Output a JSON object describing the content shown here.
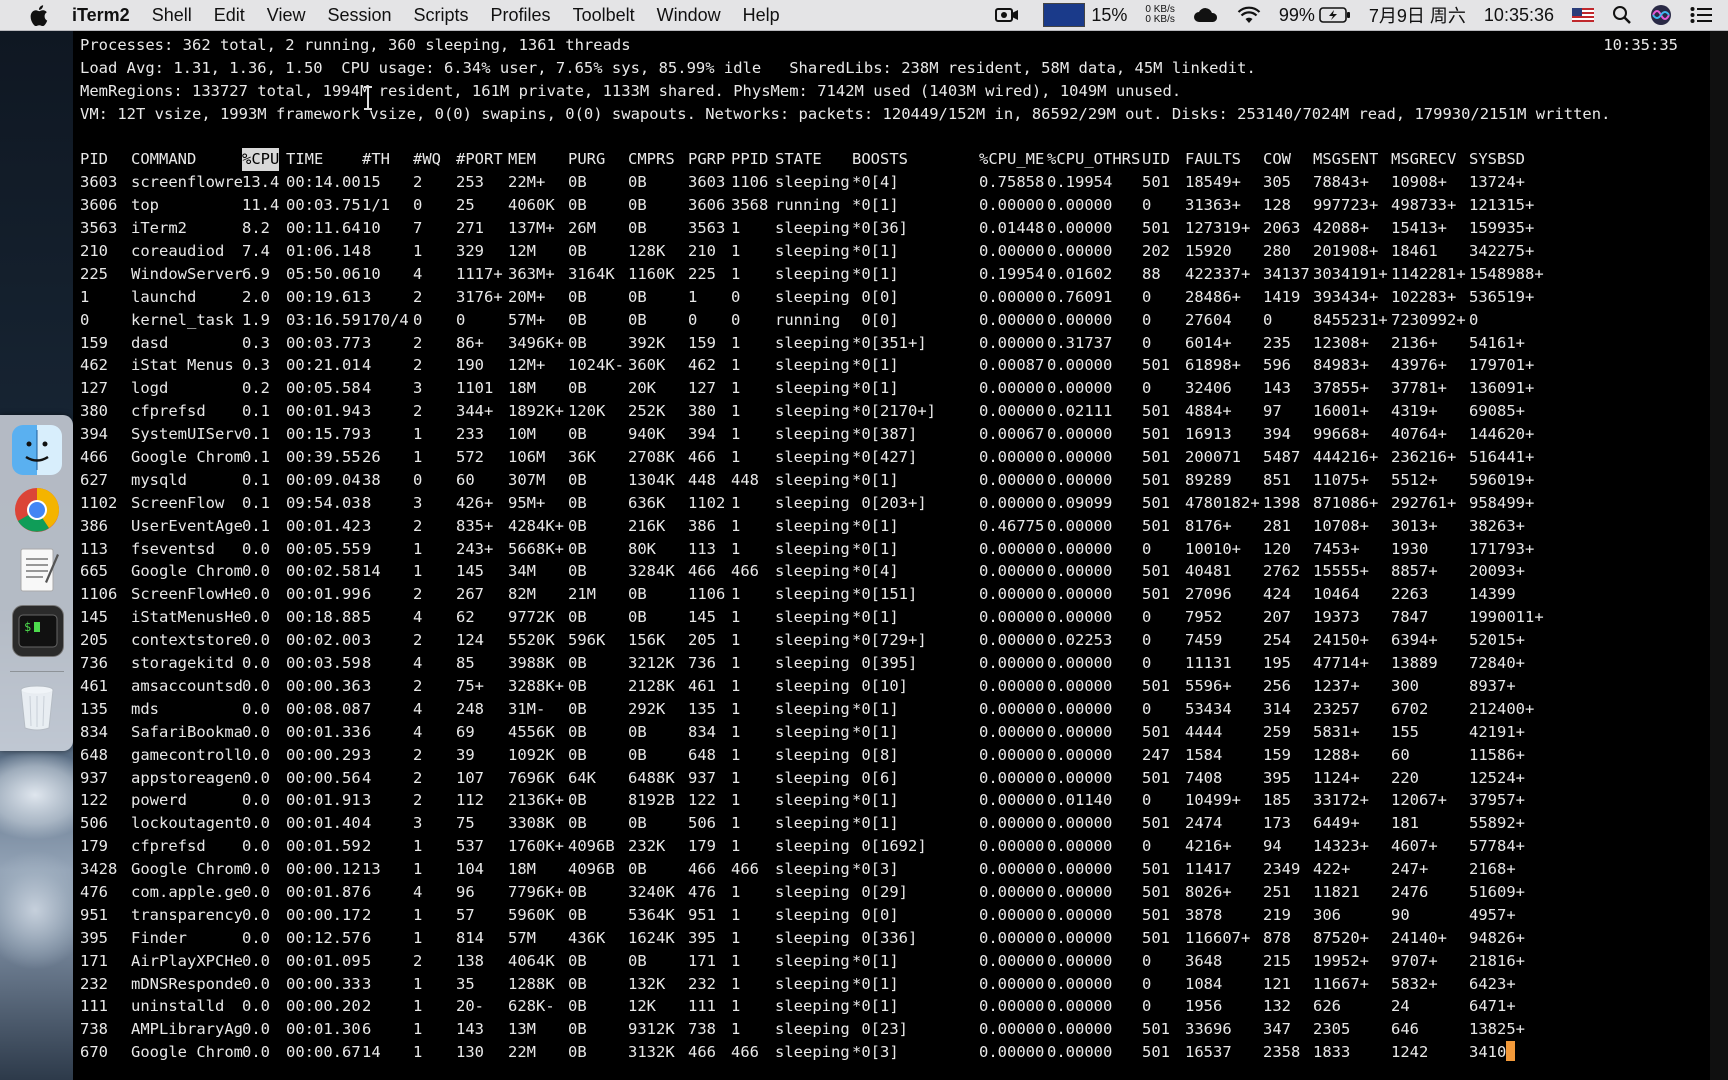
{
  "menubar": {
    "app_name": "iTerm2",
    "menus": [
      "Shell",
      "Edit",
      "View",
      "Session",
      "Scripts",
      "Profiles",
      "Toolbelt",
      "Window",
      "Help"
    ],
    "status": {
      "cpu_percent": "15%",
      "net_up": "0 KB/s",
      "net_down": "0 KB/s",
      "battery": "99%",
      "date": "7月9日 周六",
      "time": "10:35:36"
    }
  },
  "dock": {
    "items": [
      "Finder",
      "Google Chrome",
      "TextEdit",
      "Terminal",
      "Trash"
    ]
  },
  "terminal": {
    "clock": "10:35:35",
    "header_lines": [
      "Processes: 362 total, 2 running, 360 sleeping, 1361 threads",
      "Load Avg: 1.31, 1.36, 1.50  CPU usage: 6.34% user, 7.65% sys, 85.99% idle   SharedLibs: 238M resident, 58M data, 45M linkedit.",
      "MemRegions: 133727 total, 1994M resident, 161M private, 1133M shared. PhysMem: 7142M used (1403M wired), 1049M unused.",
      "VM: 12T vsize, 1993M framework vsize, 0(0) swapins, 0(0) swapouts. Networks: packets: 120449/152M in, 86592/29M out. Disks: 253140/7024M read, 179930/2151M written."
    ],
    "columns": [
      "PID",
      "COMMAND",
      "%CPU",
      "TIME",
      "#TH",
      "#WQ",
      "#PORT",
      "MEM",
      "PURG",
      "CMPRS",
      "PGRP",
      "PPID",
      "STATE",
      "BOOSTS",
      "%CPU_ME",
      "%CPU_OTHRS",
      "UID",
      "FAULTS",
      "COW",
      "MSGSENT",
      "MSGRECV",
      "SYSBSD"
    ],
    "sorted_column": "%CPU",
    "rows": [
      [
        "3603",
        "screenflowre",
        "13.4",
        "00:14.00",
        "15",
        "2",
        "253",
        "22M+",
        "0B",
        "0B",
        "3603",
        "1106",
        "sleeping",
        "*0[4]",
        "0.75858",
        "0.19954",
        "501",
        "18549+",
        "305",
        "78843+",
        "10908+",
        "13724+"
      ],
      [
        "3606",
        "top",
        "11.4",
        "00:03.75",
        "1/1",
        "0",
        "25",
        "4060K",
        "0B",
        "0B",
        "3606",
        "3568",
        "running",
        "*0[1]",
        "0.00000",
        "0.00000",
        "0",
        "31363+",
        "128",
        "997723+",
        "498733+",
        "121315+"
      ],
      [
        "3563",
        "iTerm2",
        "8.2",
        "00:11.64",
        "10",
        "7",
        "271",
        "137M+",
        "26M",
        "0B",
        "3563",
        "1",
        "sleeping",
        "*0[36]",
        "0.01448",
        "0.00000",
        "501",
        "127319+",
        "2063",
        "42088+",
        "15413+",
        "159935+"
      ],
      [
        "210",
        "coreaudiod",
        "7.4",
        "01:06.14",
        "8",
        "1",
        "329",
        "12M",
        "0B",
        "128K",
        "210",
        "1",
        "sleeping",
        "*0[1]",
        "0.00000",
        "0.00000",
        "202",
        "15920",
        "280",
        "201908+",
        "18461",
        "342275+"
      ],
      [
        "225",
        "WindowServer",
        "6.9",
        "05:50.06",
        "10",
        "4",
        "1117+",
        "363M+",
        "3164K",
        "1160K",
        "225",
        "1",
        "sleeping",
        "*0[1]",
        "0.19954",
        "0.01602",
        "88",
        "422337+",
        "34137",
        "3034191+",
        "1142281+",
        "1548988+"
      ],
      [
        "1",
        "launchd",
        "2.0",
        "00:19.61",
        "3",
        "2",
        "3176+",
        "20M+",
        "0B",
        "0B",
        "1",
        "0",
        "sleeping",
        " 0[0]",
        "0.00000",
        "0.76091",
        "0",
        "28486+",
        "1419",
        "393434+",
        "102283+",
        "536519+"
      ],
      [
        "0",
        "kernel_task",
        "1.9",
        "03:16.59",
        "170/4",
        "0",
        "0",
        "57M+",
        "0B",
        "0B",
        "0",
        "0",
        "running",
        " 0[0]",
        "0.00000",
        "0.00000",
        "0",
        "27604",
        "0",
        "8455231+",
        "7230992+",
        "0"
      ],
      [
        "159",
        "dasd",
        "0.3",
        "00:03.77",
        "3",
        "2",
        "86+",
        "3496K+",
        "0B",
        "392K",
        "159",
        "1",
        "sleeping",
        "*0[351+]",
        "0.00000",
        "0.31737",
        "0",
        "6014+",
        "235",
        "12308+",
        "2136+",
        "54161+"
      ],
      [
        "462",
        "iStat Menus",
        "0.3",
        "00:21.01",
        "4",
        "2",
        "190",
        "12M+",
        "1024K-",
        "360K",
        "462",
        "1",
        "sleeping",
        "*0[1]",
        "0.00087",
        "0.00000",
        "501",
        "61898+",
        "596",
        "84983+",
        "43976+",
        "179701+"
      ],
      [
        "127",
        "logd",
        "0.2",
        "00:05.58",
        "4",
        "3",
        "1101",
        "18M",
        "0B",
        "20K",
        "127",
        "1",
        "sleeping",
        "*0[1]",
        "0.00000",
        "0.00000",
        "0",
        "32406",
        "143",
        "37855+",
        "37781+",
        "136091+"
      ],
      [
        "380",
        "cfprefsd",
        "0.1",
        "00:01.94",
        "3",
        "2",
        "344+",
        "1892K+",
        "120K",
        "252K",
        "380",
        "1",
        "sleeping",
        "*0[2170+]",
        "0.00000",
        "0.02111",
        "501",
        "4884+",
        "97",
        "16001+",
        "4319+",
        "69085+"
      ],
      [
        "394",
        "SystemUIServ",
        "0.1",
        "00:15.79",
        "3",
        "1",
        "233",
        "10M",
        "0B",
        "940K",
        "394",
        "1",
        "sleeping",
        "*0[387]",
        "0.00067",
        "0.00000",
        "501",
        "16913",
        "394",
        "99668+",
        "40764+",
        "144620+"
      ],
      [
        "466",
        "Google Chrom",
        "0.1",
        "00:39.55",
        "26",
        "1",
        "572",
        "106M",
        "36K",
        "2708K",
        "466",
        "1",
        "sleeping",
        "*0[427]",
        "0.00000",
        "0.00000",
        "501",
        "200071",
        "5487",
        "444216+",
        "236216+",
        "516441+"
      ],
      [
        "627",
        "mysqld",
        "0.1",
        "00:09.04",
        "38",
        "0",
        "60",
        "307M",
        "0B",
        "1304K",
        "448",
        "448",
        "sleeping",
        "*0[1]",
        "0.00000",
        "0.00000",
        "501",
        "89289",
        "851",
        "11075+",
        "5512+",
        "596019+"
      ],
      [
        "1102",
        "ScreenFlow",
        "0.1",
        "09:54.03",
        "8",
        "3",
        "426+",
        "95M+",
        "0B",
        "636K",
        "1102",
        "1",
        "sleeping",
        " 0[203+]",
        "0.00000",
        "0.09099",
        "501",
        "4780182+",
        "1398",
        "871086+",
        "292761+",
        "958499+"
      ],
      [
        "386",
        "UserEventAge",
        "0.1",
        "00:01.42",
        "3",
        "2",
        "835+",
        "4284K+",
        "0B",
        "216K",
        "386",
        "1",
        "sleeping",
        "*0[1]",
        "0.46775",
        "0.00000",
        "501",
        "8176+",
        "281",
        "10708+",
        "3013+",
        "38263+"
      ],
      [
        "113",
        "fseventsd",
        "0.0",
        "00:05.55",
        "9",
        "1",
        "243+",
        "5668K+",
        "0B",
        "80K",
        "113",
        "1",
        "sleeping",
        "*0[1]",
        "0.00000",
        "0.00000",
        "0",
        "10010+",
        "120",
        "7453+",
        "1930",
        "171793+"
      ],
      [
        "665",
        "Google Chrom",
        "0.0",
        "00:02.58",
        "14",
        "1",
        "145",
        "34M",
        "0B",
        "3284K",
        "466",
        "466",
        "sleeping",
        "*0[4]",
        "0.00000",
        "0.00000",
        "501",
        "40481",
        "2762",
        "15555+",
        "8857+",
        "20093+"
      ],
      [
        "1106",
        "ScreenFlowHe",
        "0.0",
        "00:01.99",
        "6",
        "2",
        "267",
        "82M",
        "21M",
        "0B",
        "1106",
        "1",
        "sleeping",
        "*0[151]",
        "0.00000",
        "0.00000",
        "501",
        "27096",
        "424",
        "10464",
        "2263",
        "14399"
      ],
      [
        "145",
        "iStatMenusHe",
        "0.0",
        "00:18.88",
        "5",
        "4",
        "62",
        "9772K",
        "0B",
        "0B",
        "145",
        "1",
        "sleeping",
        "*0[1]",
        "0.00000",
        "0.00000",
        "0",
        "7952",
        "207",
        "19373",
        "7847",
        "1990011+"
      ],
      [
        "205",
        "contextstore",
        "0.0",
        "00:02.00",
        "3",
        "2",
        "124",
        "5520K",
        "596K",
        "156K",
        "205",
        "1",
        "sleeping",
        "*0[729+]",
        "0.00000",
        "0.02253",
        "0",
        "7459",
        "254",
        "24150+",
        "6394+",
        "52015+"
      ],
      [
        "736",
        "storagekitd",
        "0.0",
        "00:03.59",
        "8",
        "4",
        "85",
        "3988K",
        "0B",
        "3212K",
        "736",
        "1",
        "sleeping",
        " 0[395]",
        "0.00000",
        "0.00000",
        "0",
        "11131",
        "195",
        "47714+",
        "13889",
        "72840+"
      ],
      [
        "461",
        "amsaccountsd",
        "0.0",
        "00:00.36",
        "3",
        "2",
        "75+",
        "3288K+",
        "0B",
        "2128K",
        "461",
        "1",
        "sleeping",
        " 0[10]",
        "0.00000",
        "0.00000",
        "501",
        "5596+",
        "256",
        "1237+",
        "300",
        "8937+"
      ],
      [
        "135",
        "mds",
        "0.0",
        "00:08.08",
        "7",
        "4",
        "248",
        "31M-",
        "0B",
        "292K",
        "135",
        "1",
        "sleeping",
        "*0[1]",
        "0.00000",
        "0.00000",
        "0",
        "53434",
        "314",
        "23257",
        "6702",
        "212400+"
      ],
      [
        "834",
        "SafariBookma",
        "0.0",
        "00:01.33",
        "6",
        "4",
        "69",
        "4556K",
        "0B",
        "0B",
        "834",
        "1",
        "sleeping",
        "*0[1]",
        "0.00000",
        "0.00000",
        "501",
        "4444",
        "259",
        "5831+",
        "155",
        "42191+"
      ],
      [
        "648",
        "gamecontroll",
        "0.0",
        "00:00.29",
        "3",
        "2",
        "39",
        "1092K",
        "0B",
        "0B",
        "648",
        "1",
        "sleeping",
        " 0[8]",
        "0.00000",
        "0.00000",
        "247",
        "1584",
        "159",
        "1288+",
        "60",
        "11586+"
      ],
      [
        "937",
        "appstoreagen",
        "0.0",
        "00:00.56",
        "4",
        "2",
        "107",
        "7696K",
        "64K",
        "6488K",
        "937",
        "1",
        "sleeping",
        " 0[6]",
        "0.00000",
        "0.00000",
        "501",
        "7408",
        "395",
        "1124+",
        "220",
        "12524+"
      ],
      [
        "122",
        "powerd",
        "0.0",
        "00:01.91",
        "3",
        "2",
        "112",
        "2136K+",
        "0B",
        "8192B",
        "122",
        "1",
        "sleeping",
        "*0[1]",
        "0.00000",
        "0.01140",
        "0",
        "10499+",
        "185",
        "33172+",
        "12067+",
        "37957+"
      ],
      [
        "506",
        "lockoutagent",
        "0.0",
        "00:01.40",
        "4",
        "3",
        "75",
        "3308K",
        "0B",
        "0B",
        "506",
        "1",
        "sleeping",
        "*0[1]",
        "0.00000",
        "0.00000",
        "501",
        "2474",
        "173",
        "6449+",
        "181",
        "55892+"
      ],
      [
        "179",
        "cfprefsd",
        "0.0",
        "00:01.59",
        "2",
        "1",
        "537",
        "1760K+",
        "4096B",
        "232K",
        "179",
        "1",
        "sleeping",
        " 0[1692]",
        "0.00000",
        "0.00000",
        "0",
        "4216+",
        "94",
        "14323+",
        "4607+",
        "57784+"
      ],
      [
        "3428",
        "Google Chrom",
        "0.0",
        "00:00.12",
        "13",
        "1",
        "104",
        "18M",
        "4096B",
        "0B",
        "466",
        "466",
        "sleeping",
        "*0[3]",
        "0.00000",
        "0.00000",
        "501",
        "11417",
        "2349",
        "422+",
        "247+",
        "2168+"
      ],
      [
        "476",
        "com.apple.ge",
        "0.0",
        "00:01.87",
        "6",
        "4",
        "96",
        "7796K+",
        "0B",
        "3240K",
        "476",
        "1",
        "sleeping",
        " 0[29]",
        "0.00000",
        "0.00000",
        "501",
        "8026+",
        "251",
        "11821",
        "2476",
        "51609+"
      ],
      [
        "951",
        "transparency",
        "0.0",
        "00:00.17",
        "2",
        "1",
        "57",
        "5960K",
        "0B",
        "5364K",
        "951",
        "1",
        "sleeping",
        " 0[0]",
        "0.00000",
        "0.00000",
        "501",
        "3878",
        "219",
        "306",
        "90",
        "4957+"
      ],
      [
        "395",
        "Finder",
        "0.0",
        "00:12.57",
        "6",
        "1",
        "814",
        "57M",
        "436K",
        "1624K",
        "395",
        "1",
        "sleeping",
        " 0[336]",
        "0.00000",
        "0.00000",
        "501",
        "116607+",
        "878",
        "87520+",
        "24140+",
        "94826+"
      ],
      [
        "171",
        "AirPlayXPCHe",
        "0.0",
        "00:01.09",
        "5",
        "2",
        "138",
        "4064K",
        "0B",
        "0B",
        "171",
        "1",
        "sleeping",
        "*0[1]",
        "0.00000",
        "0.00000",
        "0",
        "3648",
        "215",
        "19952+",
        "9707+",
        "21816+"
      ],
      [
        "232",
        "mDNSResponde",
        "0.0",
        "00:00.33",
        "3",
        "1",
        "35",
        "1288K",
        "0B",
        "132K",
        "232",
        "1",
        "sleeping",
        "*0[1]",
        "0.00000",
        "0.00000",
        "0",
        "1084",
        "121",
        "11667+",
        "5832+",
        "6423+"
      ],
      [
        "111",
        "uninstalld",
        "0.0",
        "00:00.20",
        "2",
        "1",
        "20-",
        "628K-",
        "0B",
        "12K",
        "111",
        "1",
        "sleeping",
        "*0[1]",
        "0.00000",
        "0.00000",
        "0",
        "1956",
        "132",
        "626",
        "24",
        "6471+"
      ],
      [
        "738",
        "AMPLibraryAg",
        "0.0",
        "00:01.30",
        "6",
        "1",
        "143",
        "13M",
        "0B",
        "9312K",
        "738",
        "1",
        "sleeping",
        " 0[23]",
        "0.00000",
        "0.00000",
        "501",
        "33696",
        "347",
        "2305",
        "646",
        "13825+"
      ],
      [
        "670",
        "Google Chrom",
        "0.0",
        "00:00.67",
        "14",
        "1",
        "130",
        "22M",
        "0B",
        "3132K",
        "466",
        "466",
        "sleeping",
        "*0[3]",
        "0.00000",
        "0.00000",
        "501",
        "16537",
        "2358",
        "1833",
        "1242",
        "3410"
      ]
    ]
  }
}
